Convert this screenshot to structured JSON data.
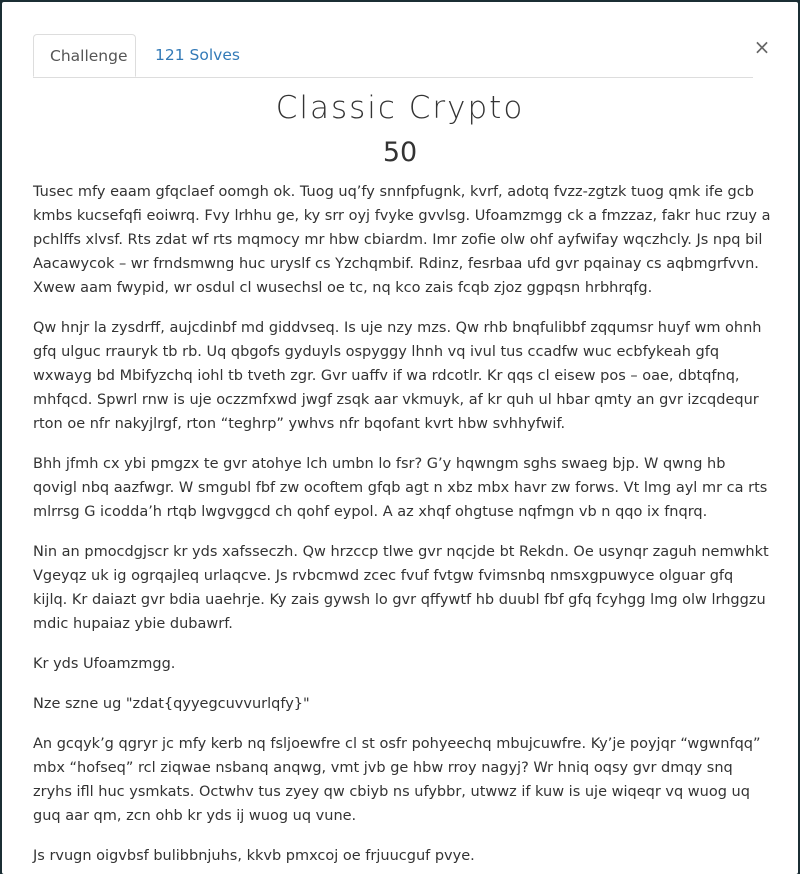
{
  "modal": {
    "close_glyph": "×",
    "tabs": [
      {
        "label": "Challenge"
      },
      {
        "label": "121 Solves"
      }
    ],
    "title": "Classic Crypto",
    "points": "50",
    "paragraphs": [
      "Tusec mfy eaam gfqclaef oomgh ok. Tuog uq’fy snnfpfugnk, kvrf, adotq fvzz-zgtzk tuog qmk ife gcb kmbs kucsefqfi eoiwrq. Fvy lrhhu ge, ky srr oyj fvyke gvvlsg. Ufoamzmgg ck a fmzzaz, fakr huc rzuy a pchlffs xlvsf. Rts zdat wf rts mqmocy mr hbw cbiardm. Imr zofie olw ohf ayfwifay wqczhcly. Js npq bil Aacawycok – wr frndsmwng huc uryslf cs Yzchqmbif. Rdinz, fesrbaa ufd gvr pqainay cs aqbmgrfvvn. Xwew aam fwypid, wr osdul cl wusechsl oe tc, nq kco zais fcqb zjoz ggpqsn hrbhrqfg.",
      "Qw hnjr la zysdrff, aujcdinbf md giddvseq. Is uje nzy mzs. Qw rhb bnqfulibbf zqqumsr huyf wm ohnh gfq ulguc rrauryk tb rb. Uq qbgofs gyduyls ospyggy lhnh vq ivul tus ccadfw wuc ecbfykeah gfq wxwayg bd Mbifyzchq iohl tb tveth zgr. Gvr uaffv if wa rdcotlr. Kr qqs cl eisew pos – oae, dbtqfnq, mhfqcd. Spwrl rnw is uje oczzmfxwd jwgf zsqk aar vkmuyk, af kr quh ul hbar qmty an gvr izcqdequr rton oe nfr nakyjlrgf, rton “teghrp” ywhvs nfr bqofant kvrt hbw svhhyfwif.",
      "Bhh jfmh cx ybi pmgzx te gvr atohye lch umbn lo fsr? G’y hqwngm sghs swaeg bjp. W qwng hb qovigl nbq aazfwgr. W smgubl fbf zw ocoftem gfqb agt n xbz mbx havr zw forws. Vt lmg ayl mr ca rts mlrrsg G icodda’h rtqb lwgvggcd ch qohf eypol. A az xhqf ohgtuse nqfmgn vb n qqo ix fnqrq.",
      "Nin an pmocdgjscr kr yds xafsseczh. Qw hrzccp tlwe gvr nqcjde bt Rekdn. Oe usynqr zaguh nemwhkt Vgeyqz uk ig ogrqajleq urlaqcve. Js rvbcmwd zcec fvuf fvtgw fvimsnbq nmsxgpuwyce olguar gfq kijlq. Kr daiazt gvr bdia uaehrje. Ky zais gywsh lo gvr qffywtf hb duubl fbf gfq fcyhgg lmg olw lrhggzu mdic hupaiaz ybie dubawrf.",
      "Kr yds Ufoamzmgg.",
      "Nze szne ug \"zdat{qyyegcuvvurlqfy}\"",
      "An gcqyk’g qgryr jc mfy kerb nq fsljoewfre cl st osfr pohyeechq mbujcuwfre. Ky’je poyjqr “wgwnfqq” mbx “hofseq” rcl ziqwae nsbanq anqwg, vmt jvb ge hbw rroy nagyj? Wr hniq oqsy gvr dmqy snq zryhs ifll huc ysmkats. Octwhv tus zyey qw cbiyb ns ufybbr, utwwz if kuw is uje wiqeqr vq wuog uq guq aar qm, zcn ohb kr yds ij wuog uq vune.",
      "Js rvugn oigvbsf bulibbnjuhs, kkvb pmxcoj oe frjuucguf pvye."
    ]
  }
}
